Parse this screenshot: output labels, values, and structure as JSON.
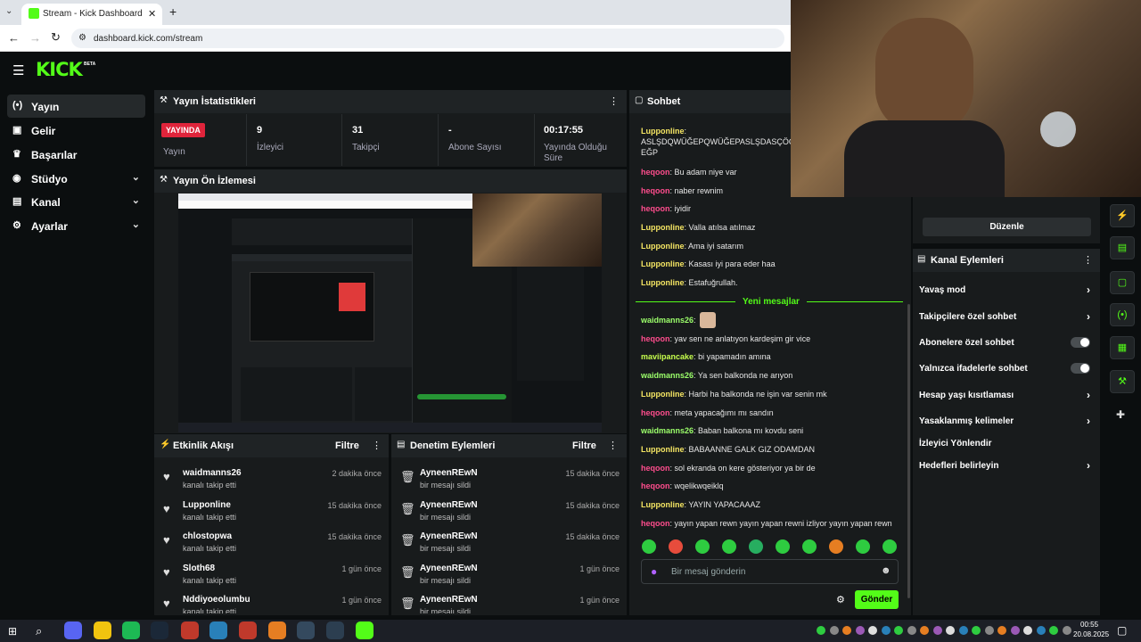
{
  "browser": {
    "tab_title": "Stream - Kick Dashboard",
    "url": "dashboard.kick.com/stream"
  },
  "brand": {
    "logo": "KICK",
    "badge": "BETA",
    "accent": "#53fc18"
  },
  "sidebar": {
    "items": [
      {
        "label": "Yayın",
        "icon": "broadcast-icon"
      },
      {
        "label": "Gelir",
        "icon": "wallet-icon"
      },
      {
        "label": "Başarılar",
        "icon": "trophy-icon"
      },
      {
        "label": "Stüdyo",
        "icon": "studio-icon"
      },
      {
        "label": "Kanal",
        "icon": "channel-icon"
      },
      {
        "label": "Ayarlar",
        "icon": "gear-icon"
      }
    ]
  },
  "stats": {
    "title": "Yayın İstatistikleri",
    "live_badge": "YAYINDA",
    "live_label": "Yayın",
    "cells": [
      {
        "value": "9",
        "label": "İzleyici"
      },
      {
        "value": "31",
        "label": "Takipçi"
      },
      {
        "value": "-",
        "label": "Abone Sayısı"
      },
      {
        "value": "00:17:55",
        "label": "Yayında Olduğu Süre"
      }
    ]
  },
  "preview": {
    "title": "Yayın Ön İzlemesi"
  },
  "activity": {
    "title": "Etkinlik Akışı",
    "filter": "Filtre",
    "rows": [
      {
        "name": "waidmanns26",
        "sub": "kanalı takip etti",
        "time": "2 dakika önce"
      },
      {
        "name": "Lupponline",
        "sub": "kanalı takip etti",
        "time": "15 dakika önce"
      },
      {
        "name": "chlostopwa",
        "sub": "kanalı takip etti",
        "time": "15 dakika önce"
      },
      {
        "name": "Sloth68",
        "sub": "kanalı takip etti",
        "time": "1 gün önce"
      },
      {
        "name": "Nddiyoeolumbu",
        "sub": "kanalı takip etti",
        "time": "1 gün önce"
      }
    ]
  },
  "moderation": {
    "title": "Denetim Eylemleri",
    "filter": "Filtre",
    "rows": [
      {
        "name": "AyneenREwN",
        "sub": "bir mesajı sildi",
        "time": "15 dakika önce"
      },
      {
        "name": "AyneenREwN",
        "sub": "bir mesajı sildi",
        "time": "15 dakika önce"
      },
      {
        "name": "AyneenREwN",
        "sub": "bir mesajı sildi",
        "time": "15 dakika önce"
      },
      {
        "name": "AyneenREwN",
        "sub": "bir mesajı sildi",
        "time": "1 gün önce"
      },
      {
        "name": "AyneenREwN",
        "sub": "bir mesajı sildi",
        "time": "1 gün önce"
      }
    ]
  },
  "chat": {
    "title": "Sohbet",
    "new_messages": "Yeni mesajlar",
    "input_placeholder": "Bir mesaj gönderin",
    "send": "Gönder",
    "messages": [
      {
        "user": "Lupponline",
        "color": "#f5e663",
        "text": "ASLŞDQWÜĞEPQWÜĞEPASLŞDASÇÖCZ EĞP"
      },
      {
        "user": "heqoon",
        "color": "#ff4d8d",
        "text": "Bu adam niye var"
      },
      {
        "user": "heqoon",
        "color": "#ff4d8d",
        "text": "naber rewnim"
      },
      {
        "user": "heqoon",
        "color": "#ff4d8d",
        "text": "iyidir"
      },
      {
        "user": "Lupponline",
        "color": "#f5e663",
        "text": "Valla atılsa atılmaz"
      },
      {
        "user": "Lupponline",
        "color": "#f5e663",
        "text": "Ama iyi satarım"
      },
      {
        "user": "Lupponline",
        "color": "#f5e663",
        "text": "Kasası iyi para eder haa"
      },
      {
        "user": "Lupponline",
        "color": "#f5e663",
        "text": "Estafuğrullah."
      },
      {
        "user": "waidmanns26",
        "color": "#9cff6b",
        "text": ""
      },
      {
        "user": "heqoon",
        "color": "#ff4d8d",
        "text": "yav sen ne anlatıyon kardeşim gir vice"
      },
      {
        "user": "maviipancake",
        "color": "#c7ff4d",
        "text": "bi yapamadın amına"
      },
      {
        "user": "waidmanns26",
        "color": "#9cff6b",
        "text": "Ya sen balkonda ne arıyon"
      },
      {
        "user": "Lupponline",
        "color": "#f5e663",
        "text": "Harbi ha balkonda ne işin var senin mk"
      },
      {
        "user": "heqoon",
        "color": "#ff4d8d",
        "text": "meta yapacağımı mı sandın"
      },
      {
        "user": "waidmanns26",
        "color": "#9cff6b",
        "text": "Baban balkona mı kovdu seni"
      },
      {
        "user": "Lupponline",
        "color": "#f5e663",
        "text": "BABAANNE GALK GIZ ODAMDAN"
      },
      {
        "user": "heqoon",
        "color": "#ff4d8d",
        "text": "sol ekranda on kere gösteriyor ya bir de"
      },
      {
        "user": "heqoon",
        "color": "#ff4d8d",
        "text": "wqelikwqeiklq"
      },
      {
        "user": "Lupponline",
        "color": "#f5e663",
        "text": "YAYIN YAPACAAAZ"
      },
      {
        "user": "heqoon",
        "color": "#ff4d8d",
        "text": "yayın yapan rewn yayın yapan rewni izliyor yayın yapan rewn"
      }
    ]
  },
  "channel_actions": {
    "edit_button": "Düzenle",
    "title": "Kanal Eylemleri",
    "rows": [
      {
        "label": "Yavaş mod",
        "kind": "chevron"
      },
      {
        "label": "Takipçilere özel sohbet",
        "kind": "chevron"
      },
      {
        "label": "Abonelere özel sohbet",
        "kind": "toggle"
      },
      {
        "label": "Yalnızca ifadelerle sohbet",
        "kind": "toggle"
      },
      {
        "label": "Hesap yaşı kısıtlaması",
        "kind": "chevron"
      },
      {
        "label": "Yasaklanmış kelimeler",
        "kind": "chevron"
      },
      {
        "label": "İzleyici Yönlendir",
        "kind": "none"
      },
      {
        "label": "Hedefleri belirleyin",
        "kind": "chevron"
      }
    ]
  },
  "taskbar": {
    "time": "00:55",
    "date": "20.08.2025"
  }
}
